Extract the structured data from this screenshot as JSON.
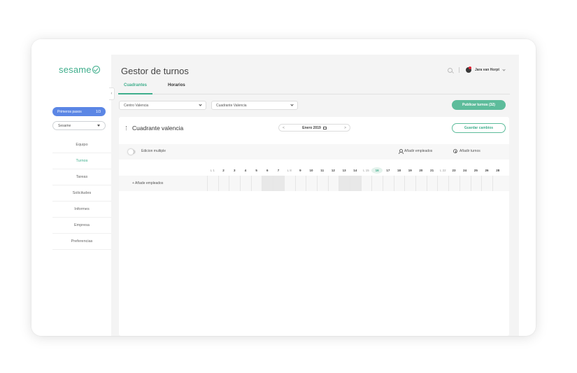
{
  "sidebar": {
    "logo": "sesame",
    "first_steps": {
      "label": "Primeros pasos",
      "progress": "1/3"
    },
    "company": "Sesame",
    "nav": [
      "Equipo",
      "Turnos",
      "Tareas",
      "Solicitudes",
      "Informes",
      "Empresa",
      "Preferencias"
    ],
    "active_nav": "Turnos"
  },
  "header": {
    "title": "Gestor de turnos",
    "user": "Jara van Horpt"
  },
  "tabs": [
    {
      "label": "Cuadrantes",
      "active": true
    },
    {
      "label": "Horarios",
      "active": false
    }
  ],
  "filters": {
    "center": "Centro Valencia",
    "roster": "Cuadrante Valencia"
  },
  "publish_label": "Publicar turnos (32)",
  "panel": {
    "title": "Cuadrante valencia",
    "month": "Enero 2019",
    "prev": "<",
    "next": ">",
    "save_label": "Guardar cambios",
    "multi_edit_label": "Edicion multiple",
    "add_employees_label": "Añadir empleados",
    "add_shifts_label": "Añadir turnos",
    "row_add_employees": "+ Añade empleados"
  },
  "calendar": {
    "days": [
      "L 1",
      "2",
      "3",
      "4",
      "5",
      "6",
      "7",
      "L 8",
      "9",
      "10",
      "11",
      "12",
      "13",
      "14",
      "L 15",
      "16",
      "17",
      "18",
      "19",
      "20",
      "21",
      "L 22",
      "23",
      "24",
      "25",
      "26",
      "28"
    ],
    "today_index": 15,
    "shaded_cells": [
      5,
      6,
      12,
      13
    ]
  },
  "colors": {
    "brand": "#3fae8c",
    "publish": "#5dbc9b",
    "first_steps": "#5b86e5"
  }
}
